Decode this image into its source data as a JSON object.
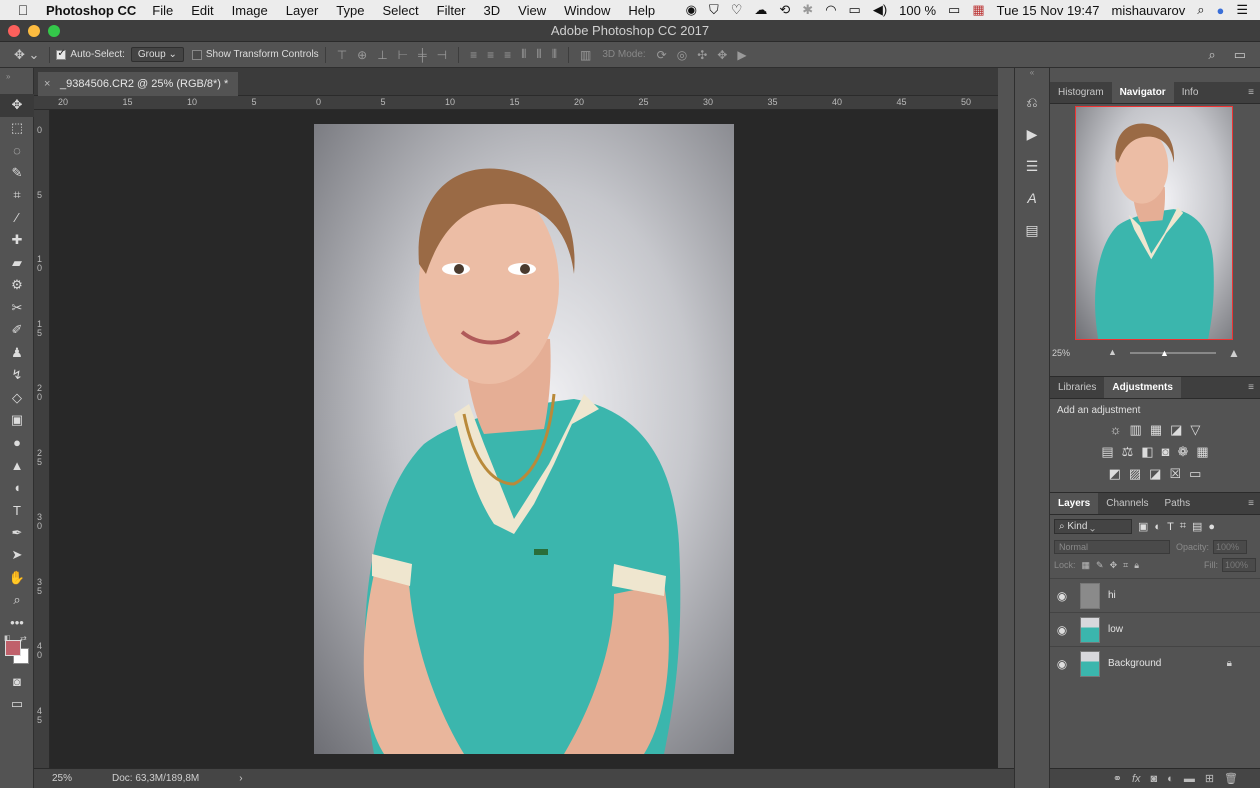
{
  "menubar": {
    "apple": "",
    "app": "Photoshop CC",
    "items": [
      "File",
      "Edit",
      "Image",
      "Layer",
      "Type",
      "Select",
      "Filter",
      "3D",
      "View",
      "Window",
      "Help"
    ],
    "battery": "100 %",
    "datetime": "Tue 15 Nov  19:47",
    "user": "mishauvarov",
    "status_icons": [
      "creative-cloud-icon",
      "vpn-icon",
      "shield-icon",
      "cloud-icon",
      "time-machine-icon",
      "bluetooth-icon",
      "wifi-icon",
      "airplay-icon",
      "volume-icon",
      "battery-icon",
      "flag-icon",
      "search-icon",
      "siri-icon",
      "list-icon"
    ]
  },
  "window": {
    "title": "Adobe Photoshop CC 2017"
  },
  "options": {
    "auto_select_label": "Auto-Select:",
    "auto_select_checked": true,
    "group_value": "Group",
    "show_transform_label": "Show Transform Controls",
    "show_transform_checked": false,
    "mode3d_label": "3D Mode:"
  },
  "document": {
    "tab_title": "_9384506.CR2 @ 25% (RGB/8*) *",
    "ruler_top": [
      "20",
      "15",
      "10",
      "5",
      "0",
      "5",
      "10",
      "15",
      "20",
      "25",
      "30",
      "35",
      "40",
      "45",
      "50"
    ],
    "ruler_left": [
      "0",
      "5",
      "1\n0",
      "1\n5",
      "2\n0",
      "2\n5",
      "3\n0",
      "3\n5",
      "4\n0",
      "4\n5"
    ]
  },
  "status": {
    "zoom": "25%",
    "doc": "Doc: 63,3M/189,8M",
    "arrow": "›"
  },
  "navigator_panel": {
    "tabs": [
      "Histogram",
      "Navigator",
      "Info"
    ],
    "active_tab": "Navigator",
    "zoom": "25%"
  },
  "adjustments_panel": {
    "tabs": [
      "Libraries",
      "Adjustments"
    ],
    "active_tab": "Adjustments",
    "title": "Add an adjustment"
  },
  "layers_panel": {
    "tabs": [
      "Layers",
      "Channels",
      "Paths"
    ],
    "active_tab": "Layers",
    "kind": "Kind",
    "blend_mode": "Normal",
    "opacity_label": "Opacity:",
    "opacity_value": "100%",
    "lock_label": "Lock:",
    "fill_label": "Fill:",
    "fill_value": "100%",
    "layers": [
      {
        "name": "hi",
        "visible": true,
        "thumb": "gray",
        "locked": false
      },
      {
        "name": "low",
        "visible": true,
        "thumb": "photo",
        "locked": false
      },
      {
        "name": "Background",
        "visible": true,
        "thumb": "photo",
        "locked": true
      }
    ]
  },
  "colors": {
    "foreground": "#c0616b",
    "background": "#ffffff",
    "shirt": "#3bb6ad"
  }
}
